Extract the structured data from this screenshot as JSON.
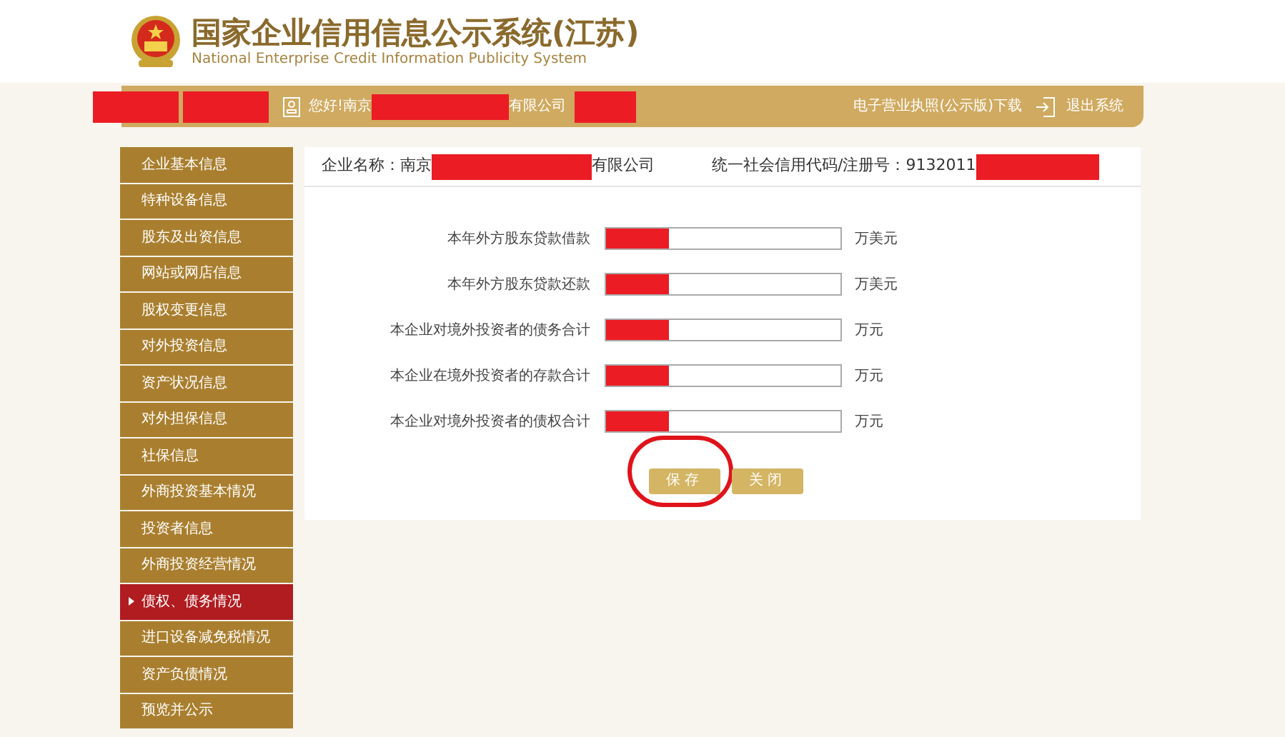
{
  "header": {
    "title": "国家企业信用信息公示系统(江苏)",
    "subtitle": "National Enterprise Credit Information Publicity System"
  },
  "top_bar": {
    "greeting": "您好!南京",
    "greeting_suffix": "有限公司",
    "download": "电子营业执照(公示版)下载",
    "logout": "退出系统"
  },
  "sidebar": {
    "items": [
      {
        "label": "企业基本信息",
        "selected": false
      },
      {
        "label": "特种设备信息",
        "selected": false
      },
      {
        "label": "股东及出资信息",
        "selected": false
      },
      {
        "label": "网站或网店信息",
        "selected": false
      },
      {
        "label": "股权变更信息",
        "selected": false
      },
      {
        "label": "对外投资信息",
        "selected": false
      },
      {
        "label": "资产状况信息",
        "selected": false
      },
      {
        "label": "对外担保信息",
        "selected": false
      },
      {
        "label": "社保信息",
        "selected": false
      },
      {
        "label": "外商投资基本情况",
        "selected": false
      },
      {
        "label": "投资者信息",
        "selected": false
      },
      {
        "label": "外商投资经营情况",
        "selected": false
      },
      {
        "label": "债权、债务情况",
        "selected": true
      },
      {
        "label": "进口设备减免税情况",
        "selected": false
      },
      {
        "label": "资产负债情况",
        "selected": false
      },
      {
        "label": "预览并公示",
        "selected": false
      }
    ]
  },
  "company": {
    "name_label": "企业名称：南京",
    "name_suffix": "有限公司",
    "code_label": "统一社会信用代码/注册号：9132011"
  },
  "form": {
    "rows": [
      {
        "label": "本年外方股东贷款借款",
        "unit": "万美元"
      },
      {
        "label": "本年外方股东贷款还款",
        "unit": "万美元"
      },
      {
        "label": "本企业对境外投资者的债务合计",
        "unit": "万元"
      },
      {
        "label": "本企业在境外投资者的存款合计",
        "unit": "万元"
      },
      {
        "label": "本企业对境外投资者的债权合计",
        "unit": "万元"
      }
    ],
    "buttons": [
      {
        "label": "保存",
        "circled": true
      },
      {
        "label": "关闭",
        "circled": false
      }
    ]
  }
}
